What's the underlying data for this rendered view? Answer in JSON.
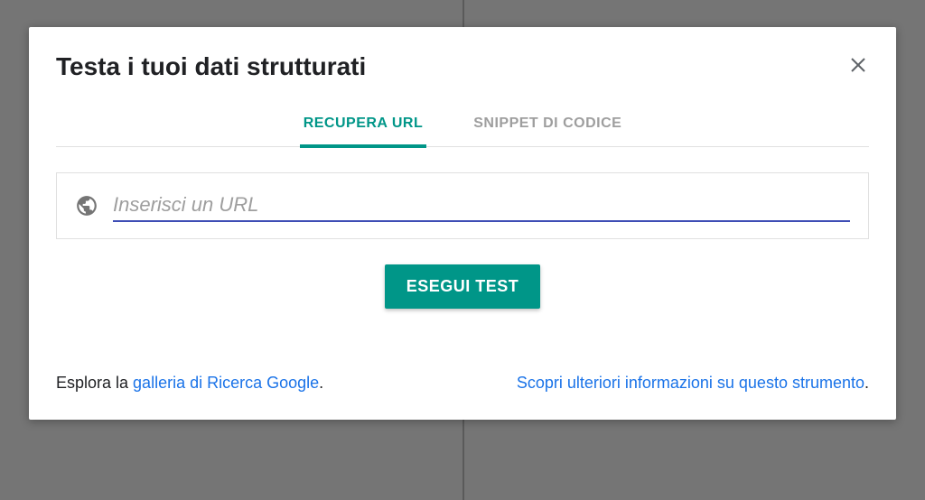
{
  "dialog": {
    "title": "Testa i tuoi dati strutturati",
    "tabs": [
      {
        "label": "RECUPERA URL",
        "active": true
      },
      {
        "label": "SNIPPET DI CODICE",
        "active": false
      }
    ],
    "input": {
      "placeholder": "Inserisci un URL",
      "value": ""
    },
    "run_button": "ESEGUI TEST",
    "footer": {
      "left_prefix": "Esplora la ",
      "left_link": "galleria di Ricerca Google",
      "left_suffix": ".",
      "right_link": "Scopri ulteriori informazioni su questo strumento",
      "right_suffix": "."
    }
  }
}
